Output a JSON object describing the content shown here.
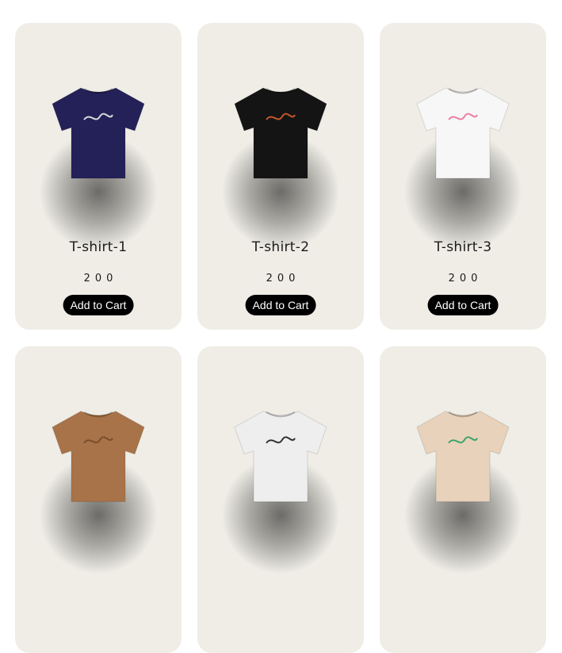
{
  "products": [
    {
      "title": "T-shirt-1",
      "price": "200",
      "button": "Add to Cart",
      "shirt_color": "#242158",
      "graphic_color": "#d9d9d9",
      "icon": "tshirt-icon"
    },
    {
      "title": "T-shirt-2",
      "price": "200",
      "button": "Add to Cart",
      "shirt_color": "#141414",
      "graphic_color": "#c2552a",
      "icon": "tshirt-icon"
    },
    {
      "title": "T-shirt-3",
      "price": "200",
      "button": "Add to Cart",
      "shirt_color": "#f7f7f7",
      "graphic_color": "#ec7fa0",
      "icon": "tshirt-icon"
    },
    {
      "title": "",
      "price": "",
      "button": "",
      "shirt_color": "#a87348",
      "graphic_color": "#7a4e2c",
      "icon": "tshirt-icon"
    },
    {
      "title": "",
      "price": "",
      "button": "",
      "shirt_color": "#eeeeef",
      "graphic_color": "#333333",
      "icon": "tshirt-icon"
    },
    {
      "title": "",
      "price": "",
      "button": "",
      "shirt_color": "#e8d2bb",
      "graphic_color": "#3ea56a",
      "icon": "tshirt-icon"
    }
  ],
  "colors": {
    "card_bg": "#efede6",
    "button_bg": "#000000",
    "button_text": "#ffffff"
  }
}
